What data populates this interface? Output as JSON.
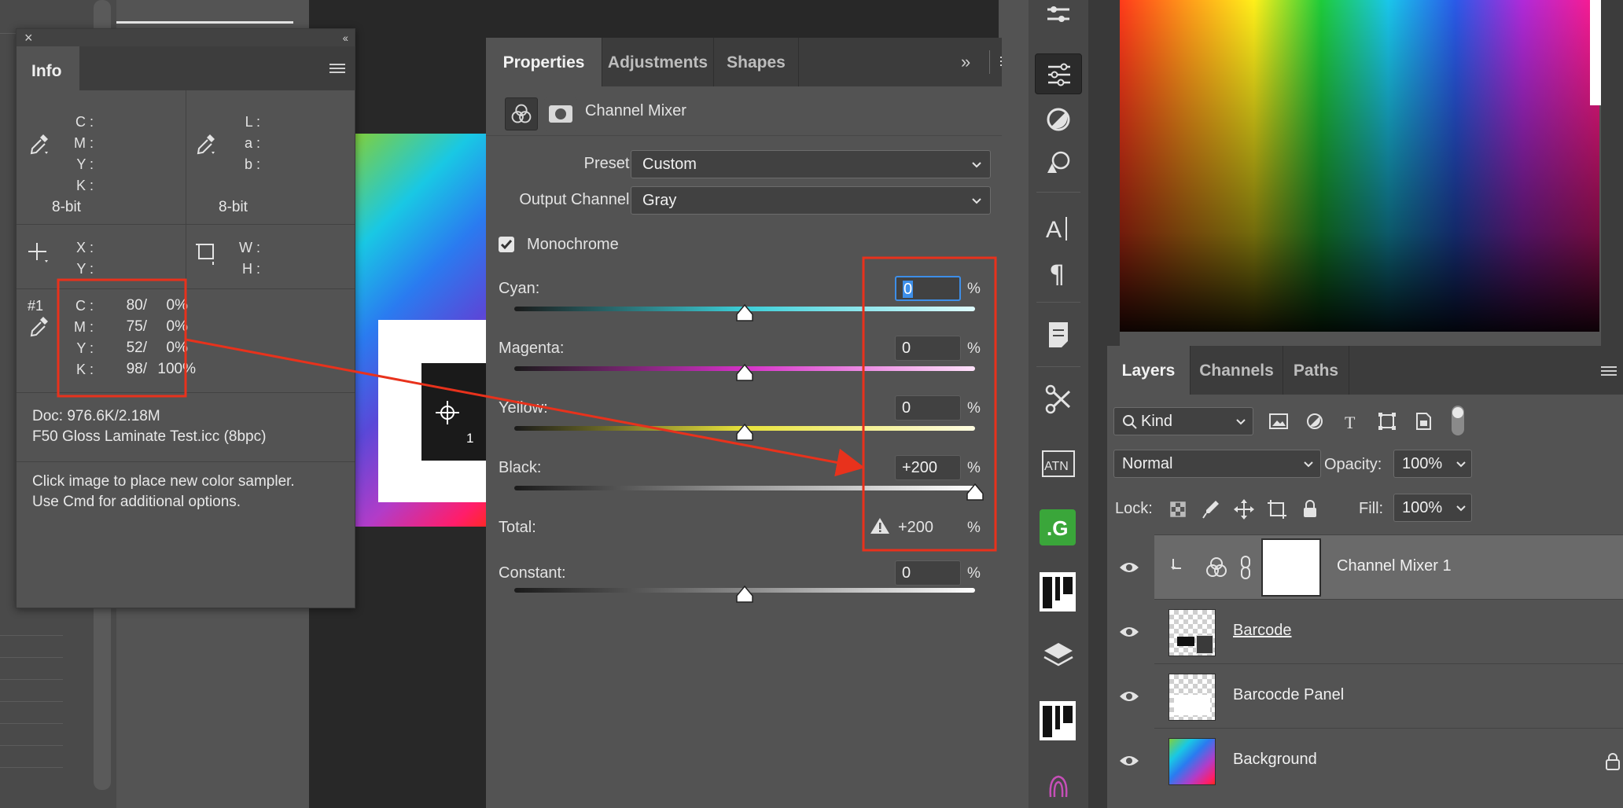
{
  "info_panel": {
    "tab": "Info",
    "cmyk_labels": [
      "C :",
      "M :",
      "Y :",
      "K :"
    ],
    "cmyk_bit": "8-bit",
    "lab_labels": [
      "L :",
      "a :",
      "b :"
    ],
    "lab_bit": "8-bit",
    "xy_labels": [
      "X :",
      "Y :"
    ],
    "wh_labels": [
      "W :",
      "H :"
    ],
    "sampler_id": "#1",
    "sampler_rows": [
      {
        "label": "C :",
        "value": "80/",
        "after": "0%"
      },
      {
        "label": "M :",
        "value": "75/",
        "after": "0%"
      },
      {
        "label": "Y :",
        "value": "52/",
        "after": "0%"
      },
      {
        "label": "K :",
        "value": "98/",
        "after": "100%"
      }
    ],
    "doc": "Doc: 976.6K/2.18M",
    "profile": "F50 Gloss Laminate Test.icc (8bpc)",
    "hint_line1": "Click image to place new color sampler.",
    "hint_line2": "Use Cmd for additional options."
  },
  "canvas": {
    "sampler_number": "1"
  },
  "properties": {
    "tabs": [
      "Properties",
      "Adjustments",
      "Shapes"
    ],
    "title": "Channel Mixer",
    "preset_label": "Preset:",
    "preset_value": "Custom",
    "output_label": "Output Channel:",
    "output_value": "Gray",
    "monochrome_label": "Monochrome",
    "monochrome_checked": true,
    "sliders": [
      {
        "label": "Cyan:",
        "value": "0",
        "fraction": 0.5,
        "focused": true
      },
      {
        "label": "Magenta:",
        "value": "0",
        "fraction": 0.5,
        "focused": false
      },
      {
        "label": "Yellow:",
        "value": "0",
        "fraction": 0.5,
        "focused": false
      },
      {
        "label": "Black:",
        "value": "+200",
        "fraction": 1.0,
        "focused": false
      }
    ],
    "total_label": "Total:",
    "total_value": "+200",
    "constant_label": "Constant:",
    "constant_value": "0",
    "constant_fraction": 0.5,
    "percent": "%"
  },
  "layers": {
    "tabs": [
      "Layers",
      "Channels",
      "Paths"
    ],
    "filter_kind": "Kind",
    "blend_mode": "Normal",
    "opacity_label": "Opacity:",
    "opacity_value": "100%",
    "lock_label": "Lock:",
    "fill_label": "Fill:",
    "fill_value": "100%",
    "items": [
      {
        "name": "Channel Mixer 1",
        "selected": true
      },
      {
        "name": "Barcode",
        "selected": false
      },
      {
        "name": "Barcocde Panel",
        "selected": false
      },
      {
        "name": "Background",
        "selected": false,
        "locked": true
      }
    ]
  },
  "colors": {
    "annotation_red": "#e8321c",
    "focus_blue": "#3d8ee8",
    "green_tool": "#3aa63a"
  }
}
